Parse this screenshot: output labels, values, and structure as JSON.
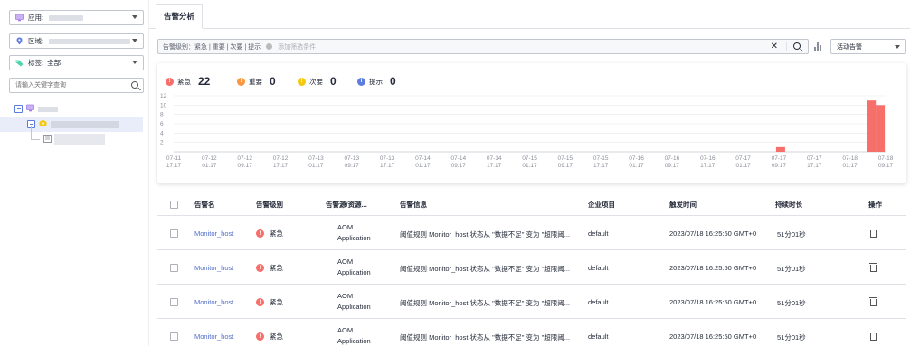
{
  "sidebar": {
    "app_label": "应用:",
    "region_label": "区域:",
    "tag_label": "标签:",
    "tag_value": "全部",
    "search_placeholder": "请输入关键字查询",
    "tree_root_label": "",
    "tree_child_label": "",
    "tree_leaf_label": ""
  },
  "tabs": [
    {
      "label": "告警分析",
      "active": true
    }
  ],
  "filter": {
    "criteria": "告警级别：紧急 | 重要 | 次要 | 提示",
    "add_hint": "添加筛选条件",
    "sort_selected": "活动告警"
  },
  "stats": [
    {
      "name": "紧急",
      "count": "22",
      "color": "#f66f6a",
      "glyph": "!"
    },
    {
      "name": "重要",
      "count": "0",
      "color": "#fa9841",
      "glyph": "!"
    },
    {
      "name": "次要",
      "count": "0",
      "color": "#f3c911",
      "glyph": "!"
    },
    {
      "name": "提示",
      "count": "0",
      "color": "#5e7ce0",
      "glyph": "i"
    }
  ],
  "colors": {
    "critical": "#f66f6a",
    "link": "#526ecc",
    "grid": "#e8e8e8"
  },
  "chart_data": {
    "type": "bar",
    "ylim": [
      0,
      12
    ],
    "yticks": [
      "12",
      "10",
      "8",
      "6",
      "4",
      "2"
    ],
    "grid": true,
    "x_ticks": [
      [
        "07-11",
        "17:17"
      ],
      [
        "07-12",
        "01:17"
      ],
      [
        "07-12",
        "09:17"
      ],
      [
        "07-12",
        "17:17"
      ],
      [
        "07-13",
        "01:17"
      ],
      [
        "07-13",
        "09:17"
      ],
      [
        "07-13",
        "17:17"
      ],
      [
        "07-14",
        "01:17"
      ],
      [
        "07-14",
        "09:17"
      ],
      [
        "07-14",
        "17:17"
      ],
      [
        "07-15",
        "01:17"
      ],
      [
        "07-15",
        "09:17"
      ],
      [
        "07-15",
        "17:17"
      ],
      [
        "07-16",
        "01:17"
      ],
      [
        "07-16",
        "09:17"
      ],
      [
        "07-16",
        "17:17"
      ],
      [
        "07-17",
        "01:17"
      ],
      [
        "07-17",
        "09:17"
      ],
      [
        "07-17",
        "17:17"
      ],
      [
        "07-18",
        "01:17"
      ],
      [
        "07-18",
        "09:17"
      ]
    ],
    "series": [
      {
        "color": "#f66f6a",
        "bars": [
          {
            "x": 17.05,
            "value": 1
          },
          {
            "x": 19.6,
            "value": 11
          },
          {
            "x": 19.85,
            "value": 10
          }
        ]
      }
    ]
  },
  "table": {
    "headers": [
      "告警名",
      "告警级别",
      "告警源/资源...",
      "告警信息",
      "企业项目",
      "触发时间",
      "持续时长",
      "操作"
    ],
    "rows": [
      {
        "name": "Monitor_host",
        "severity": "紧急",
        "source1": "AOM",
        "source2": "Application",
        "info": "阈值规则 Monitor_host 状态从 \"数据不足\" 变为 \"超限阈...",
        "project": "default",
        "time": "2023/07/18 16:25:50 GMT+0",
        "duration": "51分01秒"
      },
      {
        "name": "Monitor_host",
        "severity": "紧急",
        "source1": "AOM",
        "source2": "Application",
        "info": "阈值规则 Monitor_host 状态从 \"数据不足\" 变为 \"超限阈...",
        "project": "default",
        "time": "2023/07/18 16:25:50 GMT+0",
        "duration": "51分01秒"
      },
      {
        "name": "Monitor_host",
        "severity": "紧急",
        "source1": "AOM",
        "source2": "Application",
        "info": "阈值规则 Monitor_host 状态从 \"数据不足\" 变为 \"超限阈...",
        "project": "default",
        "time": "2023/07/18 16:25:50 GMT+0",
        "duration": "51分01秒"
      },
      {
        "name": "Monitor_host",
        "severity": "紧急",
        "source1": "AOM",
        "source2": "Application",
        "info": "阈值规则 Monitor_host 状态从 \"数据不足\" 变为 \"超限阈...",
        "project": "default",
        "time": "2023/07/18 16:25:50 GMT+0",
        "duration": "51分01秒"
      }
    ]
  }
}
